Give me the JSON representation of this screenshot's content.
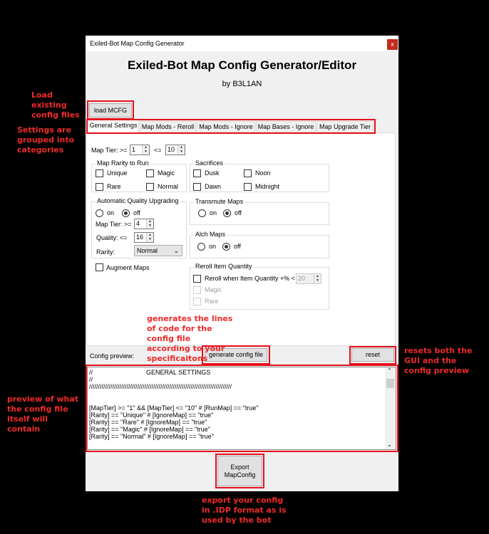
{
  "window": {
    "title": "Exiled-Bot Map Config Generator",
    "close": "x"
  },
  "header": {
    "title": "Exiled-Bot Map Config Generator/Editor",
    "author": "by B3L1AN"
  },
  "load_button": "load MCFG",
  "tabs": [
    {
      "label": "General Settings",
      "active": true
    },
    {
      "label": "Map Mods - Reroll"
    },
    {
      "label": "Map Mods - Ignore"
    },
    {
      "label": "Map Bases - Ignore"
    },
    {
      "label": "Map Upgrade Tier"
    }
  ],
  "general": {
    "map_tier_label": "Map Tier: >=",
    "map_tier_min": "1",
    "le_label": "<=",
    "map_tier_max": "10",
    "rarity_group": {
      "title": "Map Rarity to Run",
      "items": [
        {
          "label": "Unique",
          "checked": false
        },
        {
          "label": "Magic",
          "checked": false
        },
        {
          "label": "Rare",
          "checked": false
        },
        {
          "label": "Normal",
          "checked": false
        }
      ]
    },
    "sacrifices": {
      "title": "Sacrifices",
      "items": [
        {
          "label": "Dusk",
          "checked": false
        },
        {
          "label": "Noon",
          "checked": false
        },
        {
          "label": "Dawn",
          "checked": false
        },
        {
          "label": "Midnight",
          "checked": false
        }
      ]
    },
    "auto_quality": {
      "title": "Automatic Quality Upgrading",
      "on": "on",
      "off": "off",
      "selected": "off",
      "tier_label": "Map Tier: >=",
      "tier": "4",
      "quality_label": "Quality: <=",
      "quality": "16",
      "rarity_label": "Rarity:",
      "rarity": "Normal"
    },
    "transmute": {
      "title": "Transmute Maps",
      "on": "on",
      "off": "off",
      "selected": "off"
    },
    "alch": {
      "title": "Alch Maps",
      "on": "on",
      "off": "off",
      "selected": "off"
    },
    "augment": {
      "label": "Augment Maps",
      "checked": false
    },
    "reroll": {
      "title": "Reroll Item Quantity",
      "label": "Reroll when Item Quantity +% <",
      "value": "20",
      "magic": "Magic",
      "rare": "Rare"
    }
  },
  "preview": {
    "label": "Config preview:",
    "generate": "generate config file",
    "reset": "reset",
    "lines": [
      "//                              GENERAL SETTINGS",
      "//",
      "////////////////////////////////////////////////////////////////////////////////",
      "",
      "",
      "[MapTier] >= \"1\" && [MapTier] <= \"10\" # [RunMap] == \"true\"",
      "[Rarity] == \"Unique\" # [IgnoreMap] == \"true\"",
      "[Rarity] == \"Rare\" # [IgnoreMap] == \"true\"",
      "[Rarity] == \"Magic\" # [IgnoreMap] == \"true\"",
      "[Rarity] == \"Normal\" # [IgnoreMap] == \"true\""
    ]
  },
  "export_button": {
    "line1": "Export",
    "line2": "MapConfig"
  },
  "annotations": {
    "load": "Load existing config files",
    "tabs": "Settings are grouped into categories",
    "generate": "generates the lines of code for the config file according to your specificaitons",
    "reset": "resets both the GUI and the config preview",
    "preview": "preview of what the config file itself will contain",
    "export": "export your config in .IDP format as is used by the bot"
  },
  "colors": {
    "annotation": "#ee2a2a",
    "close": "#c42b1c"
  }
}
